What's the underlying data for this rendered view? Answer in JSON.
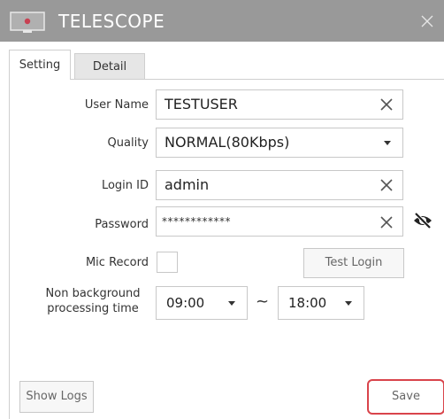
{
  "window": {
    "title": "TELESCOPE",
    "close_icon": "close-x-icon",
    "app_icon": "monitor-record-icon"
  },
  "tabs": [
    {
      "label": "Setting",
      "active": true
    },
    {
      "label": "Detail",
      "active": false
    }
  ],
  "form": {
    "user_name": {
      "label": "User Name",
      "value": "TESTUSER"
    },
    "quality": {
      "label": "Quality",
      "value": "NORMAL(80Kbps)"
    },
    "login_id": {
      "label": "Login ID",
      "value": "admin"
    },
    "password": {
      "label": "Password",
      "value": "************"
    },
    "mic_record": {
      "label": "Mic Record",
      "checked": false
    },
    "test_login_label": "Test Login",
    "non_bg": {
      "label_line1": "Non background",
      "label_line2": "processing time",
      "start": "09:00",
      "separator": "~",
      "end": "18:00"
    }
  },
  "footer": {
    "show_logs_label": "Show Logs",
    "save_label": "Save"
  },
  "colors": {
    "titlebar": "#999999",
    "save_highlight": "#d9444b",
    "icon_red": "#c84152"
  }
}
